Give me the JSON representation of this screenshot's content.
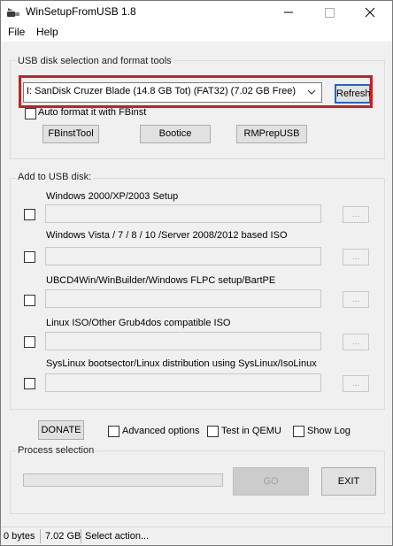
{
  "window": {
    "title": "WinSetupFromUSB 1.8"
  },
  "menu": {
    "file": "File",
    "help": "Help"
  },
  "usb_group": {
    "title": "USB disk selection and format tools",
    "disk_select": {
      "selected": "I: SanDisk Cruzer Blade (14.8 GB Tot) (FAT32) (7.02 GB Free)"
    },
    "refresh_label": "Refresh",
    "auto_format_label": "Auto format it with FBinst",
    "auto_format_checked": false,
    "tools": [
      "FBinstTool",
      "Bootice",
      "RMPrepUSB"
    ],
    "highlight_color": "#cc1f1f"
  },
  "add_group": {
    "title": "Add to USB disk:",
    "rows": [
      {
        "label": "Windows 2000/XP/2003 Setup",
        "checked": false,
        "path": "",
        "browse": "..."
      },
      {
        "label": "Windows Vista / 7 / 8 / 10 /Server 2008/2012 based ISO",
        "checked": false,
        "path": "",
        "browse": "..."
      },
      {
        "label": "UBCD4Win/WinBuilder/Windows FLPC setup/BartPE",
        "checked": false,
        "path": "",
        "browse": "..."
      },
      {
        "label": "Linux ISO/Other Grub4dos compatible ISO",
        "checked": false,
        "path": "",
        "browse": "..."
      },
      {
        "label": "SysLinux bootsector/Linux distribution using SysLinux/IsoLinux",
        "checked": false,
        "path": "",
        "browse": "..."
      }
    ]
  },
  "options": {
    "donate_label": "DONATE",
    "advanced_label": "Advanced options",
    "qemu_label": "Test in QEMU",
    "showlog_label": "Show Log"
  },
  "process": {
    "title": "Process selection",
    "progress": 0,
    "go_label": "GO",
    "exit_label": "EXIT"
  },
  "status": {
    "written": "0 bytes",
    "free": "7.02 GB",
    "message": "Select action..."
  }
}
